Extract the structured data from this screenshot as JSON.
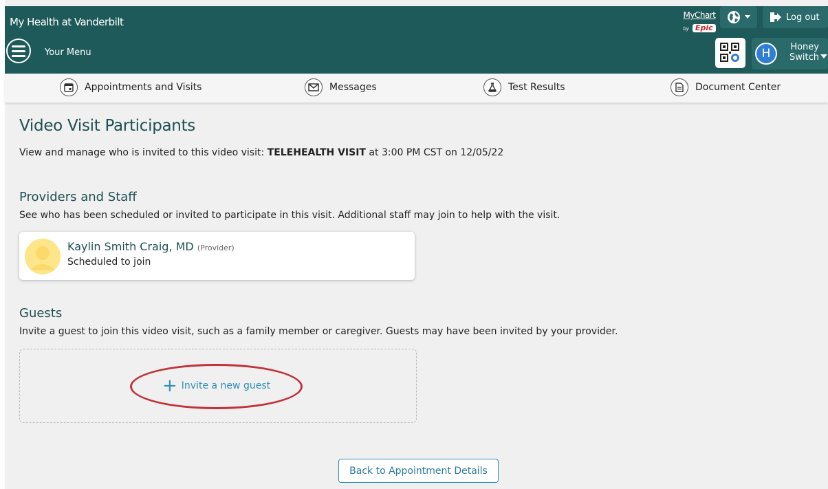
{
  "header": {
    "brand": "My Health at Vanderbilt",
    "menu_label": "Your Menu",
    "mychart_text": "MyChart",
    "mychart_by": "by",
    "epic_text": "Epic",
    "logout_label": "Log out",
    "user_name": "Honey",
    "user_switch": "Switch",
    "user_initial": "H"
  },
  "tabs": [
    {
      "label": "Appointments and Visits",
      "icon": "calendar-icon"
    },
    {
      "label": "Messages",
      "icon": "envelope-icon"
    },
    {
      "label": "Test Results",
      "icon": "flask-icon"
    },
    {
      "label": "Document Center",
      "icon": "document-icon"
    }
  ],
  "page": {
    "title": "Video Visit Participants",
    "subtitle_prefix": "View and manage who is invited to this video visit: ",
    "visit_type": "TELEHEALTH VISIT",
    "subtitle_suffix": " at 3:00 PM CST on 12/05/22"
  },
  "providers": {
    "heading": "Providers and Staff",
    "description": "See who has been scheduled or invited to participate in this visit. Additional staff may join to help with the visit.",
    "items": [
      {
        "name": "Kaylin Smith Craig, MD",
        "role": "(Provider)",
        "status": "Scheduled to join"
      }
    ]
  },
  "guests": {
    "heading": "Guests",
    "description": "Invite a guest to join this video visit, such as a family member or caregiver. Guests may have been invited by your provider.",
    "invite_label": "Invite a new guest"
  },
  "actions": {
    "back_label": "Back to Appointment Details"
  },
  "colors": {
    "header_bg": "#1f5a5b",
    "link": "#2f8fb3",
    "highlight_oval": "#c0343a"
  }
}
